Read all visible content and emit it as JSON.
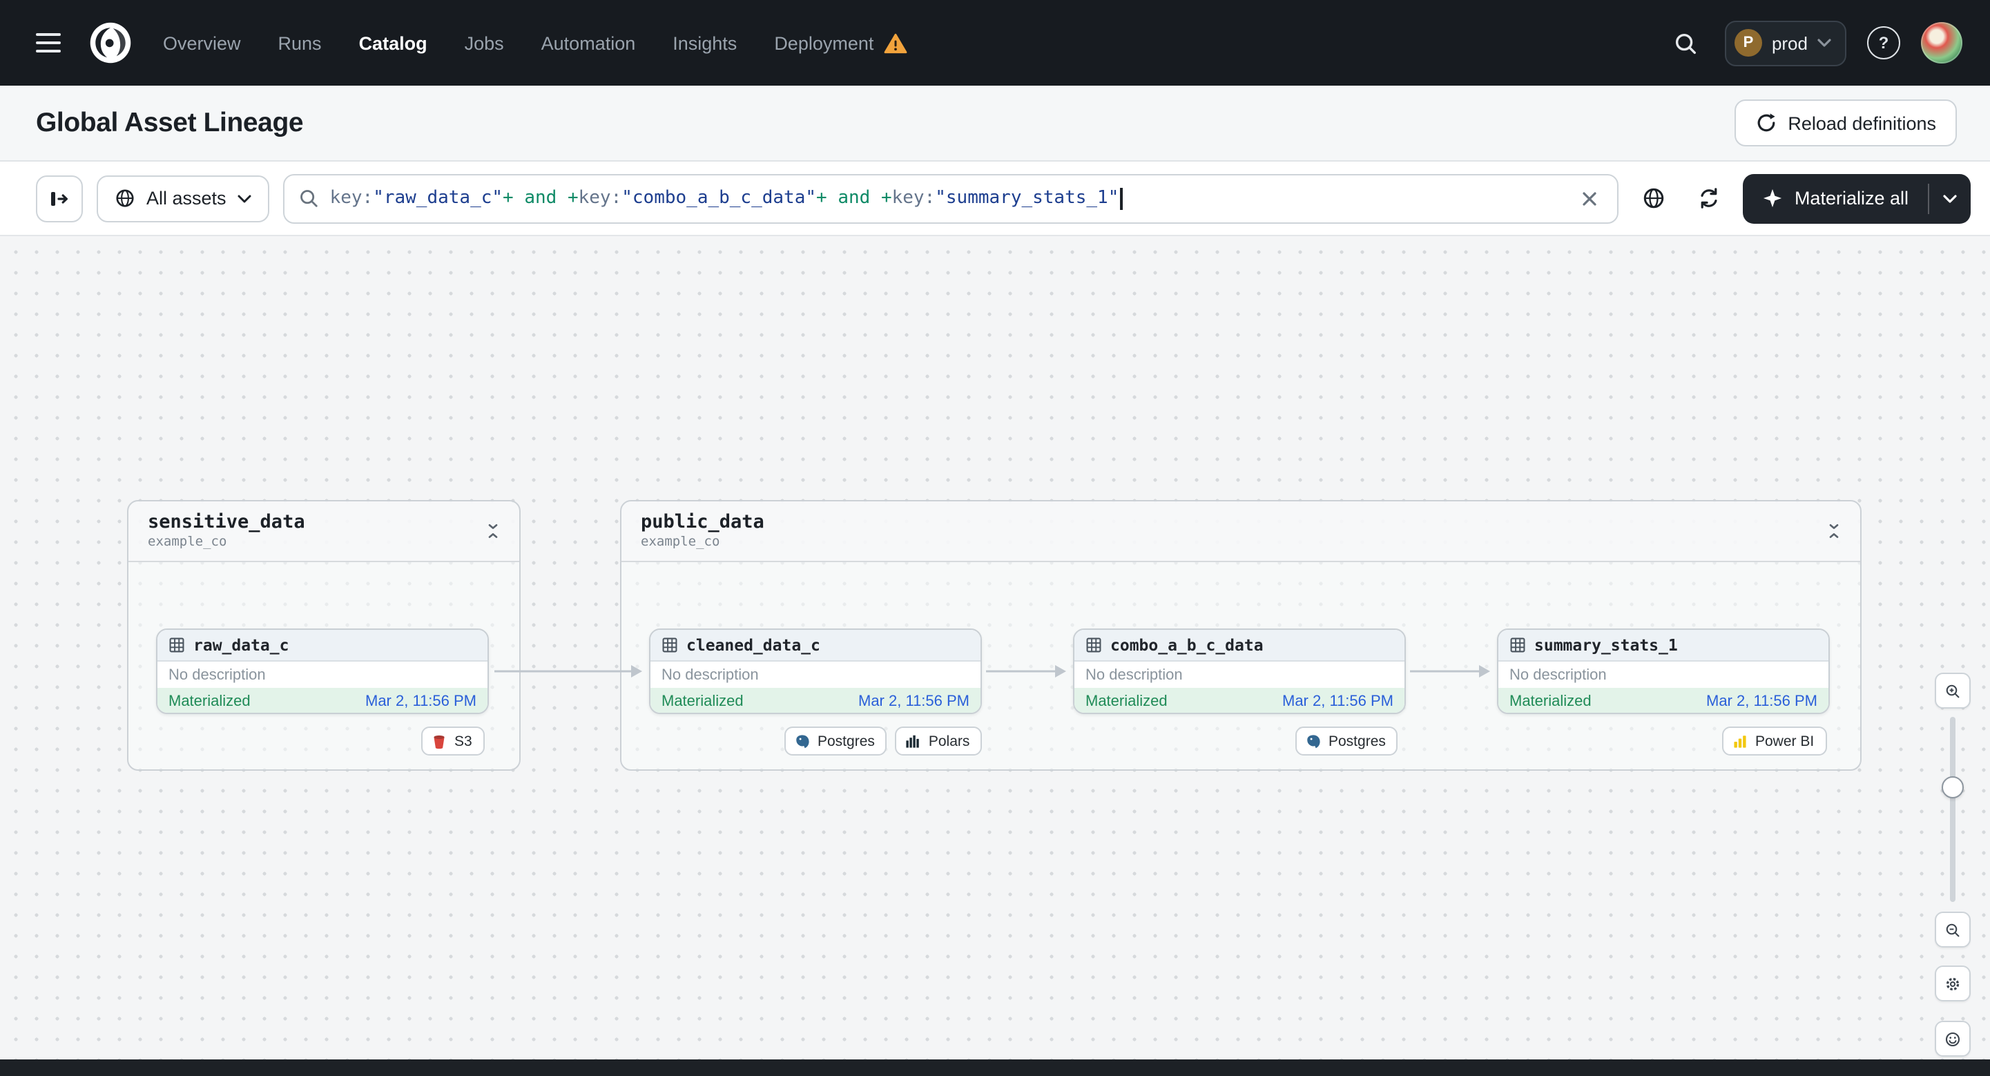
{
  "nav": {
    "items": [
      {
        "label": "Overview"
      },
      {
        "label": "Runs"
      },
      {
        "label": "Catalog",
        "active": true
      },
      {
        "label": "Jobs"
      },
      {
        "label": "Automation"
      },
      {
        "label": "Insights"
      },
      {
        "label": "Deployment",
        "warning": true
      }
    ],
    "deployment_switcher": {
      "initial": "P",
      "label": "prod"
    }
  },
  "page_header": {
    "title": "Global Asset Lineage",
    "reload_button": "Reload definitions"
  },
  "toolbar": {
    "asset_filter": {
      "label": "All assets"
    },
    "search": {
      "tokens": [
        {
          "text": "key:",
          "kind": "key"
        },
        {
          "text": "\"raw_data_c\"",
          "kind": "value"
        },
        {
          "text": "+ and +",
          "kind": "operator"
        },
        {
          "text": "key:",
          "kind": "key"
        },
        {
          "text": "\"combo_a_b_c_data\"",
          "kind": "value"
        },
        {
          "text": "+ and +",
          "kind": "operator"
        },
        {
          "text": "key:",
          "kind": "key"
        },
        {
          "text": "\"summary_stats_1\"",
          "kind": "value"
        }
      ]
    },
    "materialize_button": {
      "label": "Materialize all"
    }
  },
  "lineage": {
    "groups": [
      {
        "title": "sensitive_data",
        "subtitle": "example_co",
        "nodes": [
          {
            "name": "raw_data_c",
            "description": "No description",
            "status": "Materialized",
            "timestamp": "Mar 2, 11:56 PM",
            "tags": [
              {
                "label": "S3",
                "icon": "s3-icon"
              }
            ]
          }
        ]
      },
      {
        "title": "public_data",
        "subtitle": "example_co",
        "nodes": [
          {
            "name": "cleaned_data_c",
            "description": "No description",
            "status": "Materialized",
            "timestamp": "Mar 2, 11:56 PM",
            "tags": [
              {
                "label": "Postgres",
                "icon": "postgres-icon"
              },
              {
                "label": "Polars",
                "icon": "polars-icon"
              }
            ]
          },
          {
            "name": "combo_a_b_c_data",
            "description": "No description",
            "status": "Materialized",
            "timestamp": "Mar 2, 11:56 PM",
            "tags": [
              {
                "label": "Postgres",
                "icon": "postgres-icon"
              }
            ]
          },
          {
            "name": "summary_stats_1",
            "description": "No description",
            "status": "Materialized",
            "timestamp": "Mar 2, 11:56 PM",
            "tags": [
              {
                "label": "Power BI",
                "icon": "powerbi-icon"
              }
            ]
          }
        ]
      }
    ]
  },
  "colors": {
    "nav_background": "#171b20",
    "status_green_text": "#1f8b57",
    "status_green_bg": "#e3f3e9",
    "timestamp_blue": "#2a5fd9",
    "warning_orange": "#f2a33c",
    "dark_button": "#20252c"
  }
}
